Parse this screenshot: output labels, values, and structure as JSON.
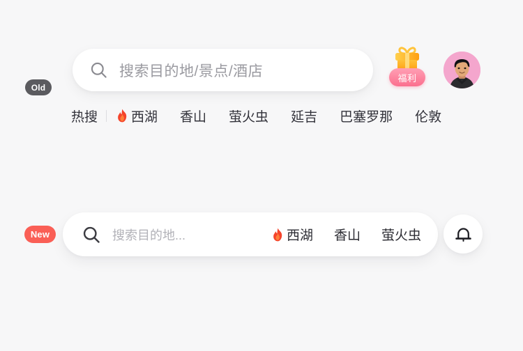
{
  "page": {
    "background_color": "#F7F7F8"
  },
  "old_variant": {
    "badge_label": "Old",
    "badge_color": "#5B5B5F",
    "search": {
      "icon": "search-icon",
      "placeholder": "搜索目的地/景点/酒店",
      "value": ""
    },
    "gift": {
      "icon": "gift-icon",
      "badge_label": "福利",
      "badge_color": "#FB6F8E"
    },
    "avatar": {
      "icon": "avatar",
      "background_color": "#F4A6CD"
    },
    "hot_search": {
      "label": "热搜",
      "items": [
        {
          "label": "西湖",
          "flame": true
        },
        {
          "label": "香山",
          "flame": false
        },
        {
          "label": "萤火虫",
          "flame": false
        },
        {
          "label": "延吉",
          "flame": false
        },
        {
          "label": "巴塞罗那",
          "flame": false
        },
        {
          "label": "伦敦",
          "flame": false
        }
      ]
    }
  },
  "new_variant": {
    "badge_label": "New",
    "badge_color": "#FA5F56",
    "search": {
      "icon": "search-icon",
      "placeholder": "搜索目的地...",
      "value": ""
    },
    "inline_tags": [
      {
        "label": "西湖",
        "flame": true
      },
      {
        "label": "香山",
        "flame": false
      },
      {
        "label": "萤火虫",
        "flame": false
      }
    ],
    "bell": {
      "icon": "bell-icon"
    }
  }
}
